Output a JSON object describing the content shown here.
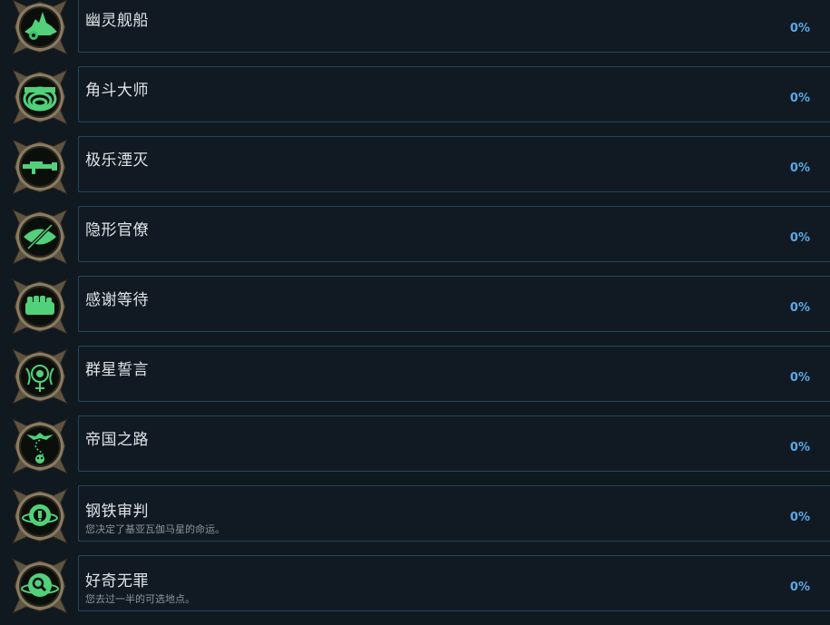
{
  "achievements": [
    {
      "title": "幽灵舰船",
      "description": "",
      "percent": "0%",
      "icon": "ghost-ship-icon"
    },
    {
      "title": "角斗大师",
      "description": "",
      "percent": "0%",
      "icon": "arena-rings-icon"
    },
    {
      "title": "极乐湮灭",
      "description": "",
      "percent": "0%",
      "icon": "rifle-icon"
    },
    {
      "title": "隐形官僚",
      "description": "",
      "percent": "0%",
      "icon": "hidden-eye-icon"
    },
    {
      "title": "感谢等待",
      "description": "",
      "percent": "0%",
      "icon": "fist-icon"
    },
    {
      "title": "群星誓言",
      "description": "",
      "percent": "0%",
      "icon": "star-oath-icon"
    },
    {
      "title": "帝国之路",
      "description": "",
      "percent": "0%",
      "icon": "imperial-path-icon"
    },
    {
      "title": "钢铁审判",
      "description": "您决定了基亚瓦伽马星的命运。",
      "percent": "0%",
      "icon": "cog-planet-icon"
    },
    {
      "title": "好奇无罪",
      "description": "您去过一半的可选地点。",
      "percent": "0%",
      "icon": "magnifier-planet-icon"
    }
  ]
}
